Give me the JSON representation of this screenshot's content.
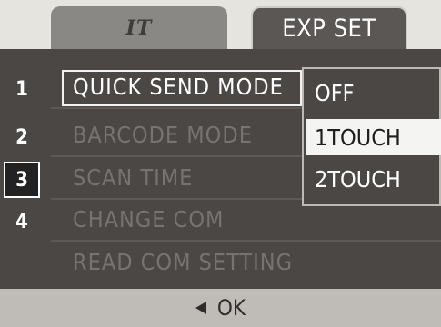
{
  "tabs": [
    {
      "label": "",
      "icon": "setup-icon-it",
      "icon_text": "IT",
      "active": false
    },
    {
      "label": "EXP SET",
      "active": true
    }
  ],
  "menu": {
    "items": [
      {
        "number": "1",
        "label": "QUICK SEND MODE",
        "active": true
      },
      {
        "number": "2",
        "label": "BARCODE MODE",
        "active": false
      },
      {
        "number": "3",
        "label": "SCAN TIME",
        "active": false
      },
      {
        "number": "4",
        "label": "CHANGE COM",
        "active": false
      },
      {
        "number": "",
        "label": "READ COM SETTING",
        "active": false
      }
    ],
    "selected_page": "3"
  },
  "popup": {
    "options": [
      "OFF",
      "1TOUCH",
      "2TOUCH"
    ],
    "selected": "1TOUCH"
  },
  "footer": {
    "back_icon": "left-triangle-icon",
    "ok_label": "OK"
  }
}
